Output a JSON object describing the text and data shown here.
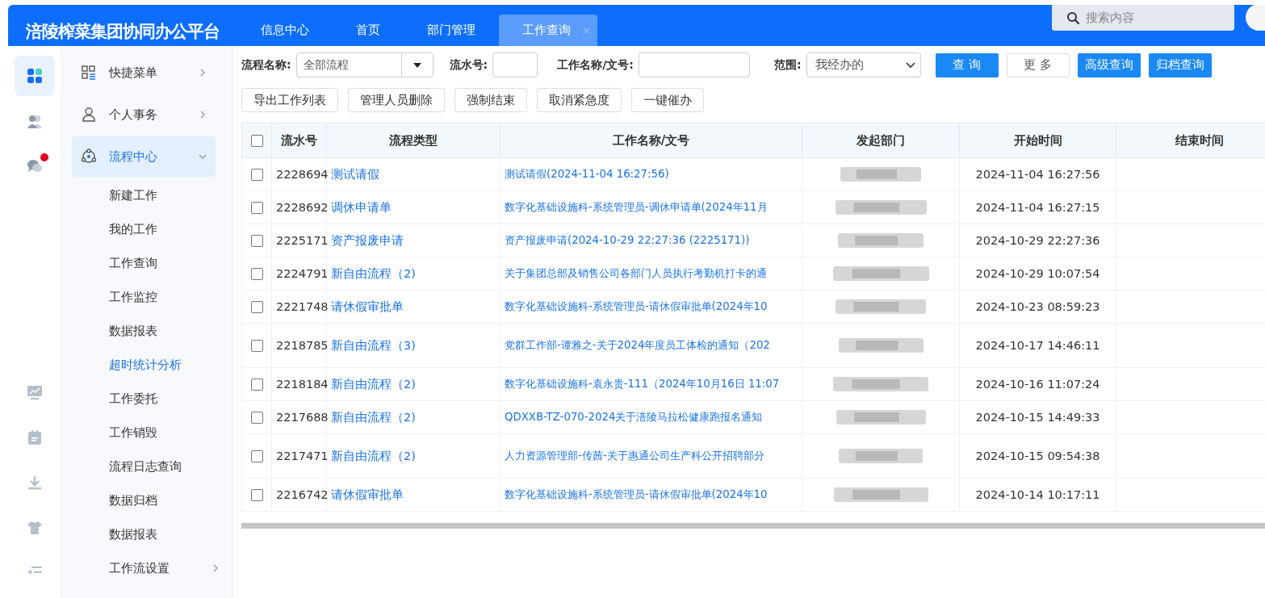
{
  "header": {
    "logo": "涪陵榨菜集团协同办公平台",
    "tabs": [
      {
        "label": "信息中心",
        "selected": false,
        "closable": false
      },
      {
        "label": "首页",
        "selected": false,
        "closable": false
      },
      {
        "label": "部门管理",
        "selected": false,
        "closable": false
      },
      {
        "label": "工作查询",
        "selected": true,
        "closable": true,
        "close": "×"
      }
    ],
    "search": {
      "placeholder": "搜索内容"
    }
  },
  "rail": [
    {
      "kind": "apps",
      "selected": true,
      "badge": false
    },
    {
      "kind": "users",
      "selected": false,
      "badge": false
    },
    {
      "kind": "chat",
      "selected": false,
      "badge": true
    },
    {
      "kind": "gap"
    },
    {
      "kind": "chart",
      "selected": false,
      "badge": false
    },
    {
      "kind": "clipboard",
      "selected": false,
      "badge": false
    },
    {
      "kind": "download",
      "selected": false,
      "badge": false
    },
    {
      "kind": "shirt",
      "selected": false,
      "badge": false
    },
    {
      "kind": "collapse",
      "selected": false,
      "badge": false
    }
  ],
  "sidebar": {
    "items": [
      {
        "label": "快捷菜单",
        "selected": false,
        "expanded": false,
        "has_children": true
      },
      {
        "label": "个人事务",
        "selected": false,
        "expanded": false,
        "has_children": true
      },
      {
        "label": "流程中心",
        "selected": true,
        "expanded": true,
        "has_children": true,
        "children": [
          {
            "label": "新建工作",
            "selected": false
          },
          {
            "label": "我的工作",
            "selected": false
          },
          {
            "label": "工作查询",
            "selected": false
          },
          {
            "label": "工作监控",
            "selected": false
          },
          {
            "label": "数据报表",
            "selected": false
          },
          {
            "label": "超时统计分析",
            "selected": true
          },
          {
            "label": "工作委托",
            "selected": false
          },
          {
            "label": "工作销毁",
            "selected": false
          },
          {
            "label": "流程日志查询",
            "selected": false
          },
          {
            "label": "数据归档",
            "selected": false
          },
          {
            "label": "数据报表",
            "selected": false
          },
          {
            "label": "工作流设置",
            "selected": false,
            "has_children": true
          }
        ]
      }
    ]
  },
  "filters": {
    "flow_name": {
      "label": "流程名称:",
      "value": "全部流程"
    },
    "serial": {
      "label": "流水号:"
    },
    "work_name": {
      "label": "工作名称/文号:"
    },
    "scope": {
      "label": "范围:",
      "value": "我经办的"
    },
    "buttons": [
      {
        "label": "查 询",
        "kind": "primary"
      },
      {
        "label": "更 多",
        "kind": "plain"
      },
      {
        "label": "高级查询",
        "kind": "primary"
      },
      {
        "label": "归档查询",
        "kind": "primary"
      }
    ]
  },
  "actions": [
    "导出工作列表",
    "管理人员删除",
    "强制结束",
    "取消紧急度",
    "一键催办"
  ],
  "table": {
    "all_checked": false,
    "columns": [
      "流水号",
      "流程类型",
      "工作名称/文号",
      "发起部门",
      "开始时间",
      "结束时间"
    ],
    "rows": [
      {
        "checked": false,
        "serial": "2228694",
        "type": "测试请假",
        "title": "测试请假(2024-11-04 16:27:56)",
        "start": "2024-11-04 16:27:56"
      },
      {
        "checked": false,
        "serial": "2228692",
        "type": "调休申请单",
        "title": "数字化基础设施科-系统管理员-调休申请单(2024年11月",
        "start": "2024-11-04 16:27:15"
      },
      {
        "checked": false,
        "serial": "2225171",
        "type": "资产报废申请",
        "title": "资产报废申请(2024-10-29 22:27:36 (2225171))",
        "start": "2024-10-29 22:27:36"
      },
      {
        "checked": false,
        "serial": "2224791",
        "type": "新自由流程（2)",
        "title": "关于集团总部及销售公司各部门人员执行考勤机打卡的通",
        "start": "2024-10-29 10:07:54"
      },
      {
        "checked": false,
        "serial": "2221748",
        "type": "请休假审批单",
        "title": "数字化基础设施科-系统管理员-请休假审批单(2024年10",
        "start": "2024-10-23 08:59:23"
      },
      {
        "checked": false,
        "serial": "2218785",
        "type": "新自由流程（3)",
        "title": "党群工作部-谭雅之-关于2024年度员工体检的通知（202",
        "start": "2024-10-17 14:46:11"
      },
      {
        "checked": false,
        "serial": "2218184",
        "type": "新自由流程（2)",
        "title": "数字化基础设施科-袁永贵-111（2024年10月16日 11:07",
        "start": "2024-10-16 11:07:24"
      },
      {
        "checked": false,
        "serial": "2217688",
        "type": "新自由流程（2)",
        "title": "QDXXB-TZ-070-2024关于涪陵马拉松健康跑报名通知",
        "start": "2024-10-15 14:49:33"
      },
      {
        "checked": false,
        "serial": "2217471",
        "type": "新自由流程（2)",
        "title": "人力资源管理部-传茜-关于惠通公司生产科公开招聘部分",
        "start": "2024-10-15 09:54:38"
      },
      {
        "checked": false,
        "serial": "2216742",
        "type": "请休假审批单",
        "title": "数字化基础设施科-系统管理员-请休假审批单(2024年10",
        "start": "2024-10-14 10:17:11"
      }
    ]
  }
}
